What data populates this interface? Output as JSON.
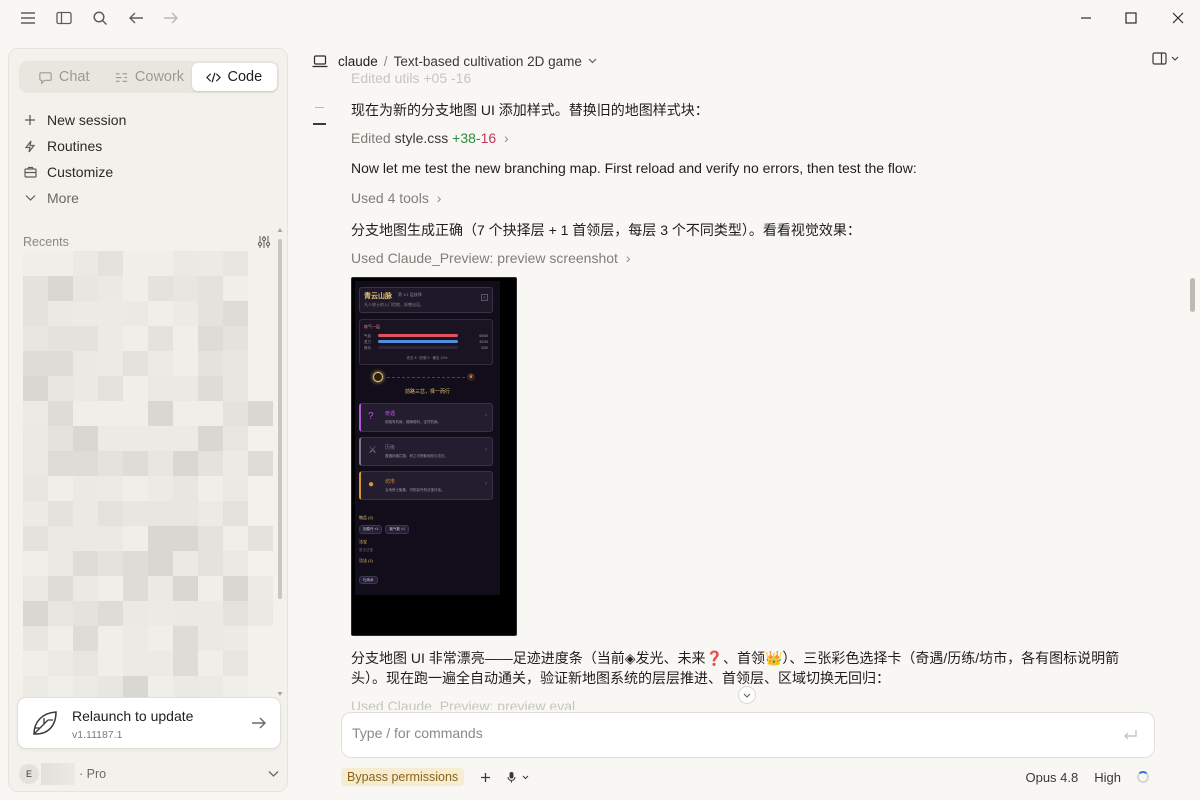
{
  "sidebar": {
    "modes": [
      {
        "label": "Chat",
        "icon": "chat-bubble-icon"
      },
      {
        "label": "Cowork",
        "icon": "cowork-icon"
      },
      {
        "label": "Code",
        "icon": "code-icon"
      }
    ],
    "nav": {
      "new_session": "New session",
      "routines": "Routines",
      "customize": "Customize",
      "more": "More"
    },
    "recents_label": "Recents",
    "update": {
      "title": "Relaunch to update",
      "version": "v1.11187.1"
    },
    "account": {
      "initial": "E",
      "plan": "· Pro"
    }
  },
  "header": {
    "project": "claude",
    "separator": "/",
    "session_title": "Text-based cultivation 2D game"
  },
  "messages": {
    "faded_top": "Edited utils +05 -16",
    "m1": "现在为新的分支地图 UI 添加样式。替换旧的地图样式块：",
    "m2_prefix": "Edited",
    "m2_file": "style.css",
    "m2_add": "+38",
    "m2_del": "-16",
    "m3": "Now let me test the new branching map. First reload and verify no errors, then test the flow:",
    "m4": "Used 4 tools",
    "m5": "分支地图生成正确（7 个抉择层 + 1 首领层，每层 3 个不同类型）。看看视觉效果：",
    "m6": "Used Claude_Preview: preview screenshot",
    "m7a": "分支地图 UI 非常漂亮——足迹进度条（当前◈发光、未来❓、首领👑）、三张彩色选择卡（奇遇/历练/坊市，各有图标说明箭",
    "m7b": "头）。现在跑一遍全自动通关，验证新地图系统的层层推进、首领层、区域切换无回归：",
    "faded_bottom": "Used Claude_Preview: preview eval"
  },
  "game_preview": {
    "title": "青云山脉",
    "subtitle": "第 1/1 层抉择",
    "desc": "凡人修士的入门险地，妖兽出没。",
    "realm": "炼气一层",
    "stat_labels": [
      "气血",
      "灵力",
      "修为"
    ],
    "stat_values": [
      "65/65",
      "30/30",
      "0/50"
    ],
    "status_line": "攻击 8 · 防御 3 · 暴击 10%",
    "heading": "前路三岔，择一而行",
    "cards": [
      {
        "name": "奇遇",
        "desc": "前路有机缘，福祸难料，全凭机缘。",
        "color": "#b05ad8",
        "icon": "?"
      },
      {
        "name": "历练",
        "desc": "遭遇妖兽拦路，斩之可获取经验与灵石。",
        "color": "#7a7a86",
        "icon": "⚔"
      },
      {
        "name": "坊市",
        "desc": "当地修士聚集，可购买丹药法宝补给。",
        "color": "#d9962c",
        "icon": "●"
      }
    ],
    "bag_label": "物品 (2)",
    "bag_items": [
      "回春丹 ×1",
      "聚气散 ×1"
    ],
    "skill_label": "法宝",
    "skill_item": "暂无法宝",
    "mission_label": "功法 (1)",
    "mission_item": "吐纳术"
  },
  "composer": {
    "placeholder": "Type / for commands"
  },
  "footer": {
    "bypass": "Bypass permissions",
    "model": "Opus 4.8",
    "effort": "High"
  }
}
